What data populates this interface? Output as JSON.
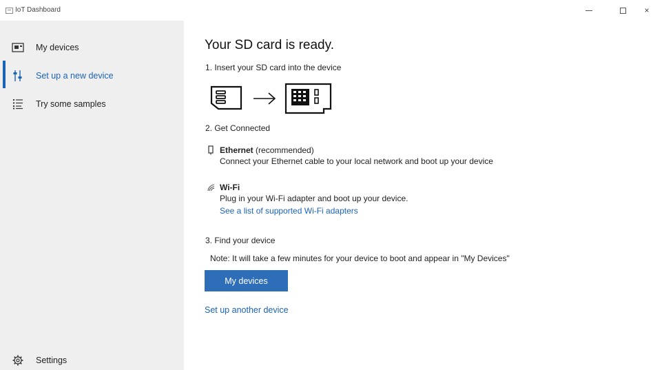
{
  "window": {
    "title": "IoT Dashboard",
    "controls": {
      "minimize_icon": "minimize-icon",
      "maximize_icon": "maximize-icon",
      "close_glyph": "×"
    }
  },
  "sidebar": {
    "items": [
      {
        "label": "My devices",
        "icon": "device-icon",
        "active": false
      },
      {
        "label": "Set up a new device",
        "icon": "sliders-icon",
        "active": true
      },
      {
        "label": "Try some samples",
        "icon": "list-icon",
        "active": false
      }
    ],
    "settings": {
      "label": "Settings",
      "icon": "gear-icon"
    },
    "accent_color": "#1b63b8"
  },
  "main": {
    "title": "Your SD card is ready.",
    "step1": "1. Insert your SD card into the device",
    "step2": "2. Get Connected",
    "ethernet": {
      "title": "Ethernet",
      "note": "(recommended)",
      "description": "Connect your Ethernet cable to your local network and boot up your device"
    },
    "wifi": {
      "title": "Wi-Fi",
      "description": "Plug in your Wi-Fi adapter and boot up your device.",
      "link": "See a list of supported Wi-Fi adapters"
    },
    "step3": "3. Find your device",
    "note": "Note: It will take a few minutes for your device to boot and appear in \"My Devices\"",
    "button_label": "My devices",
    "button_color": "#2e6db8",
    "another_link": "Set up another device"
  }
}
